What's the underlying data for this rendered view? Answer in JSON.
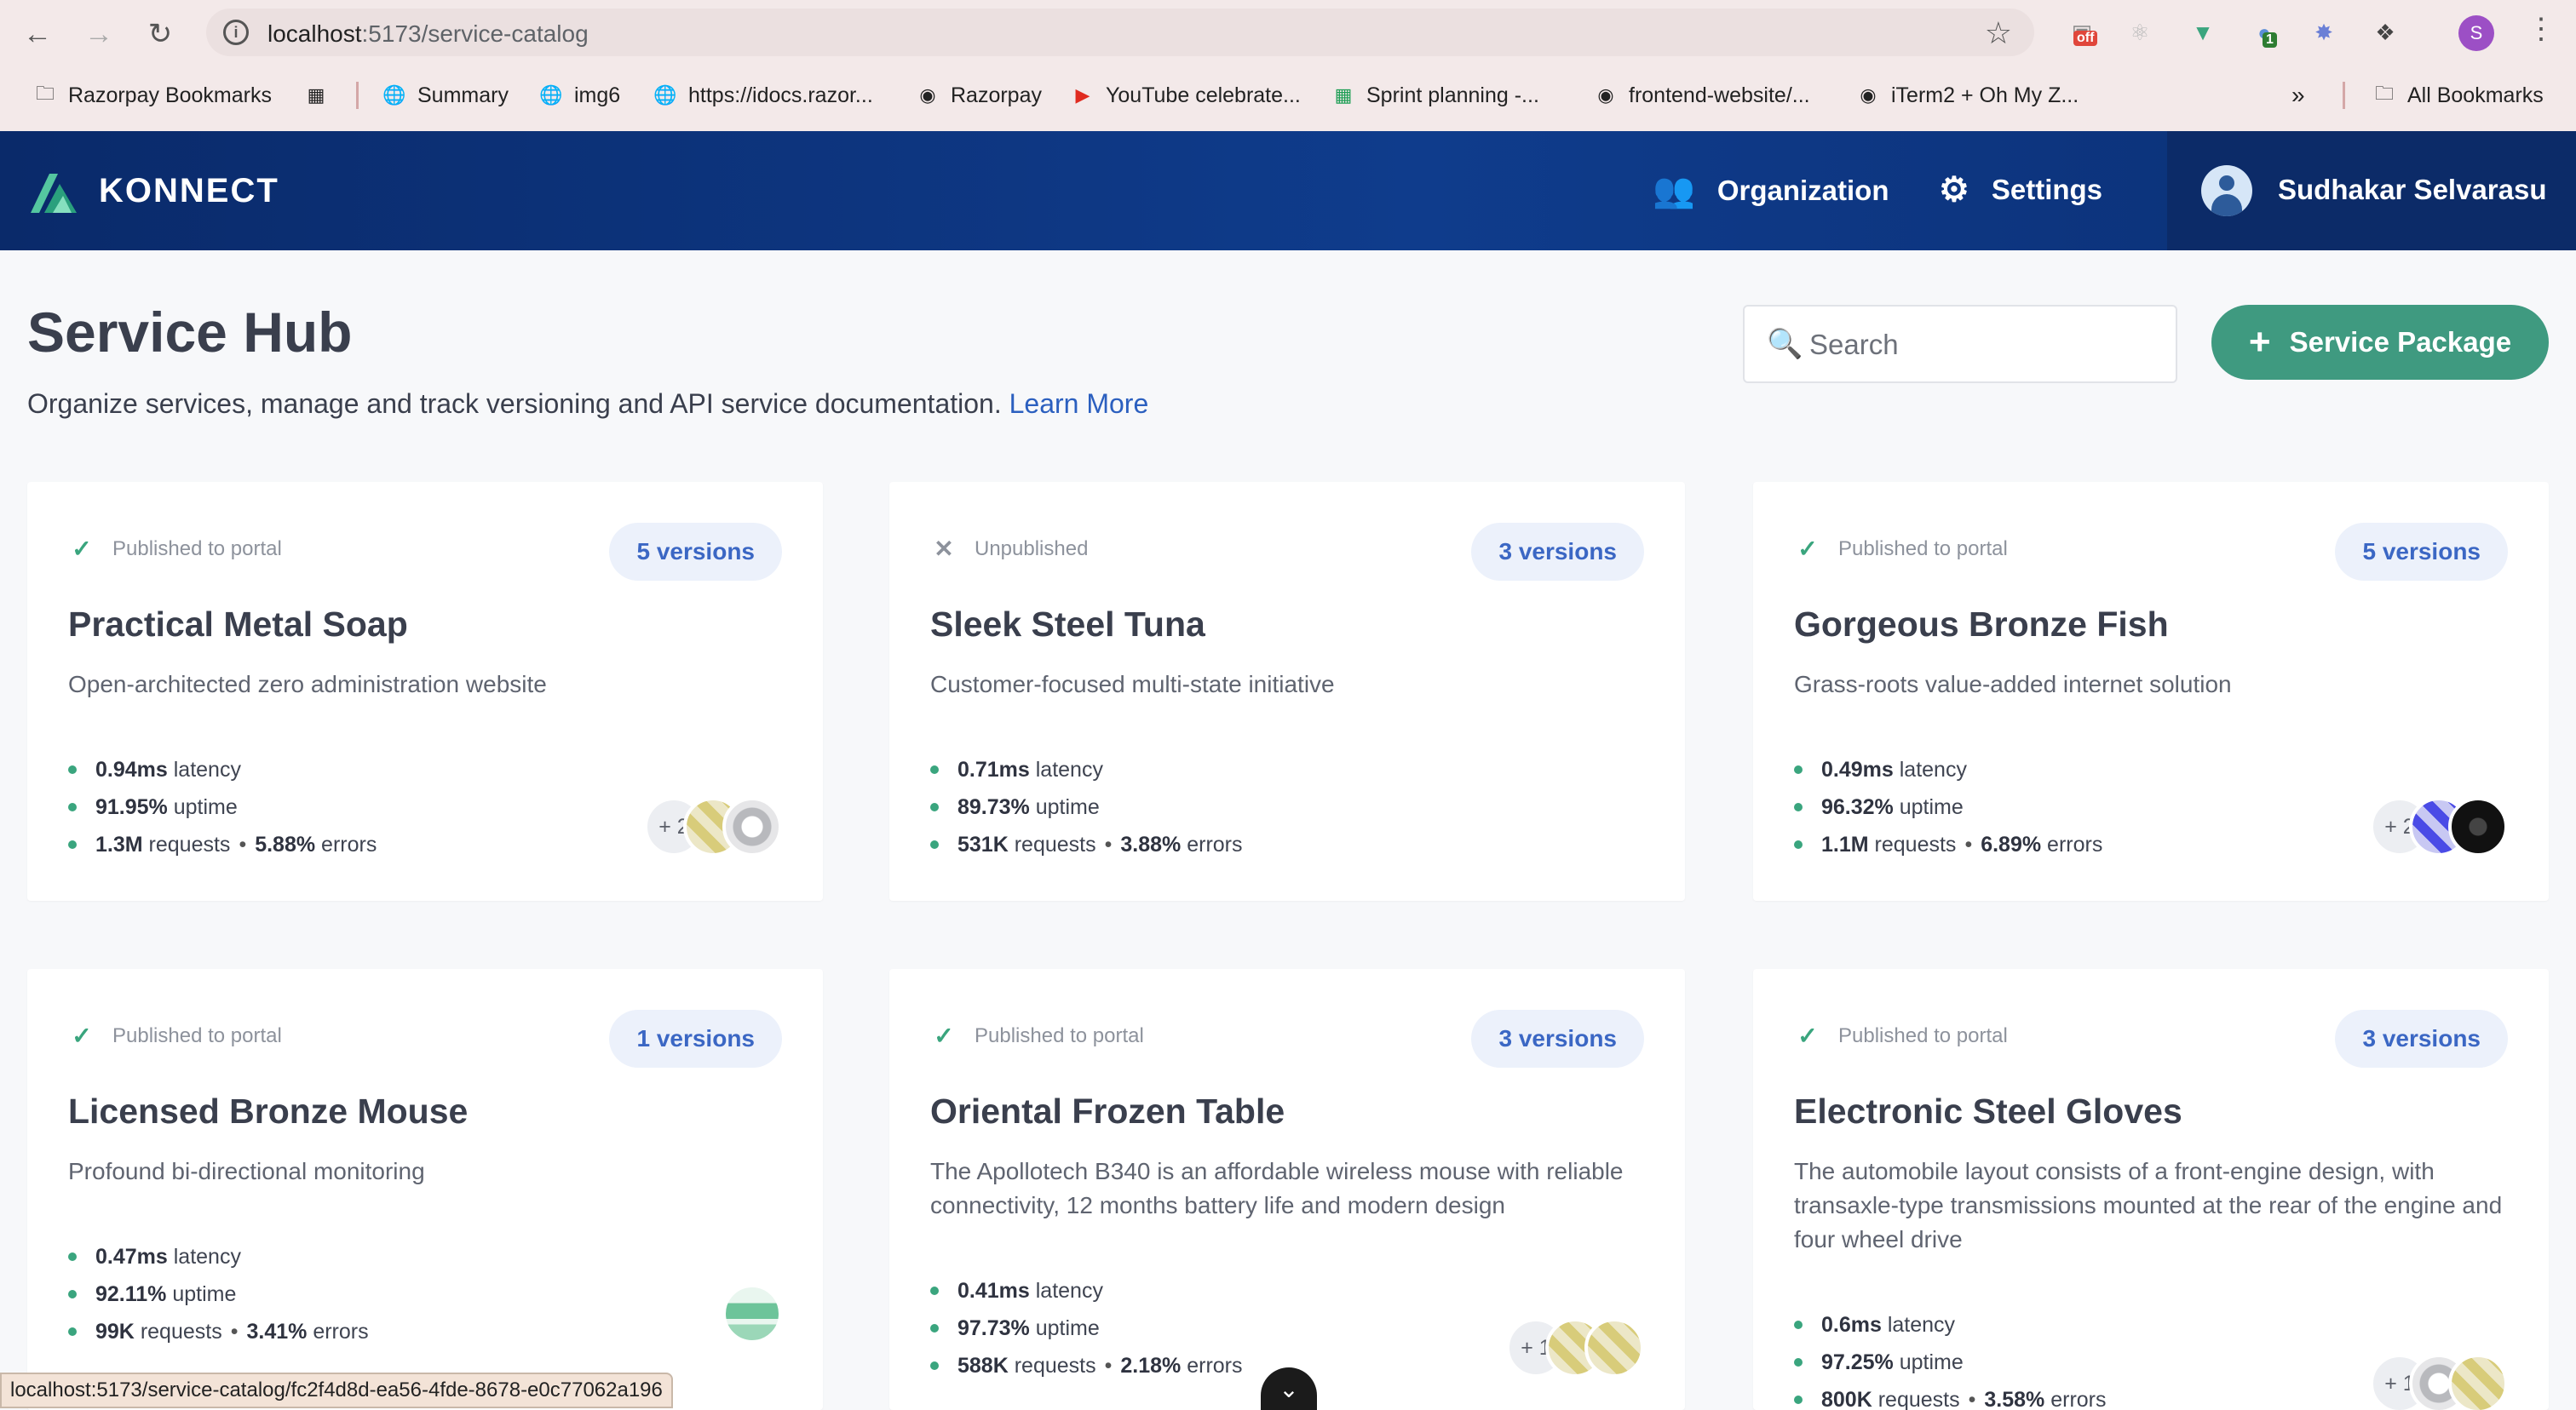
{
  "browser": {
    "url_host": "localhost",
    "url_path": ":5173/service-catalog",
    "extensions": [
      {
        "name": "pixel-perfect-icon",
        "badge": "off",
        "badge_color": "#e0463b"
      },
      {
        "name": "react-devtools-icon"
      },
      {
        "name": "vue-devtools-icon"
      },
      {
        "name": "extension-icon",
        "badge": "1",
        "badge_color": "#2e7d32"
      },
      {
        "name": "settings-extension-icon"
      },
      {
        "name": "puzzle-icon"
      }
    ],
    "profile_initial": "S",
    "bookmarks": [
      {
        "label": "Razorpay Bookmarks",
        "icon": "folder-icon"
      },
      {
        "label": "",
        "icon": "apps-grid-icon"
      },
      {
        "label": "Summary",
        "icon": "globe-icon"
      },
      {
        "label": "img6",
        "icon": "globe-icon"
      },
      {
        "label": "https://idocs.razor...",
        "icon": "globe-icon"
      },
      {
        "label": "Razorpay",
        "icon": "github-icon"
      },
      {
        "label": "YouTube celebrate...",
        "icon": "youtube-icon"
      },
      {
        "label": "Sprint planning -...",
        "icon": "sheets-icon"
      },
      {
        "label": "frontend-website/...",
        "icon": "github-icon"
      },
      {
        "label": "iTerm2 + Oh My Z...",
        "icon": "github-icon"
      },
      {
        "label": "All Bookmarks",
        "icon": "folder-icon"
      }
    ],
    "status_url": "localhost:5173/service-catalog/fc2f4d8d-ea56-4fde-8678-e0c77062a196"
  },
  "app": {
    "logo_text": "KONNECT",
    "nav": {
      "organization": "Organization",
      "settings": "Settings"
    },
    "user_name": "Sudhakar Selvarasu",
    "accent": "#3f9a80"
  },
  "page": {
    "title": "Service Hub",
    "subtitle": "Organize services, manage and track versioning and API service documentation.",
    "learn_more": "Learn More",
    "search_placeholder": "Search",
    "add_button": "Service Package"
  },
  "cards": [
    {
      "status": "Published to portal",
      "published": true,
      "versions": "5 versions",
      "title": "Practical Metal Soap",
      "description": "Open-architected zero administration website",
      "latency": "0.94ms",
      "uptime": "91.95%",
      "requests": "1.3M",
      "errors": "5.88%",
      "more": "+ 2"
    },
    {
      "status": "Unpublished",
      "published": false,
      "versions": "3 versions",
      "title": "Sleek Steel Tuna",
      "description": "Customer-focused multi-state initiative",
      "latency": "0.71ms",
      "uptime": "89.73%",
      "requests": "531K",
      "errors": "3.88%",
      "more": ""
    },
    {
      "status": "Published to portal",
      "published": true,
      "versions": "5 versions",
      "title": "Gorgeous Bronze Fish",
      "description": "Grass-roots value-added internet solution",
      "latency": "0.49ms",
      "uptime": "96.32%",
      "requests": "1.1M",
      "errors": "6.89%",
      "more": "+ 2"
    },
    {
      "status": "Published to portal",
      "published": true,
      "versions": "1 versions",
      "title": "Licensed Bronze Mouse",
      "description": "Profound bi-directional monitoring",
      "latency": "0.47ms",
      "uptime": "92.11%",
      "requests": "99K",
      "errors": "3.41%",
      "more": ""
    },
    {
      "status": "Published to portal",
      "published": true,
      "versions": "3 versions",
      "title": "Oriental Frozen Table",
      "description": "The Apollotech B340 is an affordable wireless mouse with reliable connectivity, 12 months battery life and modern design",
      "latency": "0.41ms",
      "uptime": "97.73%",
      "requests": "588K",
      "errors": "2.18%",
      "more": "+ 1"
    },
    {
      "status": "Published to portal",
      "published": true,
      "versions": "3 versions",
      "title": "Electronic Steel Gloves",
      "description": "The automobile layout consists of a front-engine design, with transaxle-type transmissions mounted at the rear of the engine and four wheel drive",
      "latency": "0.6ms",
      "uptime": "97.25%",
      "requests": "800K",
      "errors": "3.58%",
      "more": "+ 1"
    }
  ],
  "labels": {
    "latency": "latency",
    "uptime": "uptime",
    "requests": "requests",
    "errors": "errors"
  }
}
